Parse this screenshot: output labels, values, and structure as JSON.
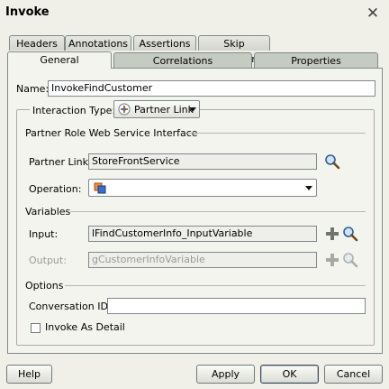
{
  "window": {
    "title": "Invoke"
  },
  "tabs_back": [
    {
      "label": "Headers"
    },
    {
      "label": "Annotations"
    },
    {
      "label": "Assertions"
    },
    {
      "label": "Skip Condition"
    }
  ],
  "tabs_front": [
    {
      "label": "General",
      "active": true
    },
    {
      "label": "Correlations"
    },
    {
      "label": "Properties"
    }
  ],
  "name": {
    "label": "Name:",
    "value": "InvokeFindCustomer"
  },
  "interaction": {
    "label": "Interaction Type:",
    "selected": "Partner Link"
  },
  "partner_section": {
    "title": "Partner Role Web Service Interface",
    "partner_link_label": "Partner Link:",
    "partner_link_value": "StoreFrontService",
    "operation_label": "Operation:",
    "operation_value": ""
  },
  "variables": {
    "title": "Variables",
    "input_label": "Input:",
    "input_value": "lFindCustomerInfo_InputVariable",
    "output_label": "Output:",
    "output_value": "gCustomerInfoVariable"
  },
  "options": {
    "title": "Options",
    "conversation_label": "Conversation ID:",
    "conversation_value": "",
    "invoke_detail_label": "Invoke As Detail",
    "invoke_detail_checked": false
  },
  "buttons": {
    "help": "Help",
    "apply": "Apply",
    "ok": "OK",
    "cancel": "Cancel"
  },
  "icons": {
    "close": "close-icon",
    "search": "search-icon",
    "add": "add-icon",
    "partner_link": "partner-link-icon",
    "operation": "operation-icon"
  },
  "colors": {
    "background": "#f0efe8",
    "panel": "#f4f4ee",
    "border": "#7f8a8c"
  }
}
